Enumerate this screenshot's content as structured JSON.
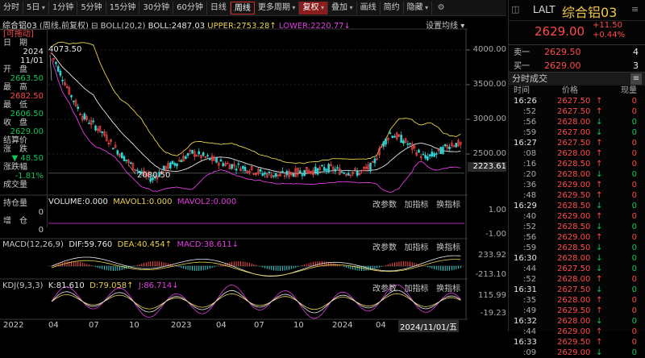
{
  "toolbar": {
    "items": [
      "分时",
      "5日",
      "1分钟",
      "5分钟",
      "15分钟",
      "30分钟",
      "60分钟",
      "日线",
      "周线",
      "更多周期",
      "复权",
      "叠加",
      "画线",
      "简约",
      "隐藏"
    ],
    "active": "周线"
  },
  "chart_header": {
    "name": "综合铝03",
    "mode": "(周线,前复权)",
    "boll": "BOLL(20,2)",
    "boll_val": "BOLL:2487.03",
    "upper": "UPPER:2753.28",
    "lower": "LOWER:2220.77",
    "set_ma": "设置均线"
  },
  "info": {
    "tag": "[可拖动]",
    "date_label": "日　期",
    "date_year": "2024",
    "date_md": "11/01",
    "open_label": "开　盘",
    "open": "2663.50",
    "high_label": "最　高",
    "high": "2682.50",
    "low_label": "最　低",
    "low": "2606.50",
    "close_label": "收　盘",
    "close": "2629.00",
    "settle_label": "结算价",
    "change_label": "涨　跌",
    "change": "48.50",
    "pct_label": "涨跌幅",
    "pct": "-1.81%",
    "vol_label": "成交量",
    "oi_label": "持仓量",
    "oi_chg_label": "增　仓",
    "zero": "0"
  },
  "price_axis": {
    "ticks": [
      "4000.00",
      "3500.00",
      "3000.00",
      "2500.00"
    ],
    "current": "2223.61",
    "max_label": "4073.50",
    "min_label": "2080.50"
  },
  "volume_panel": {
    "title": "VOLUME:0.000",
    "ma1": "MAVOL1:0.000",
    "ma2": "MAVOL2:0.000",
    "btns": [
      "改参数",
      "加指标",
      "换指标"
    ],
    "ticks": [
      "1.00",
      "-1.00"
    ]
  },
  "macd_panel": {
    "title": "MACD(12,26,9)",
    "dif": "DIF:59.760",
    "dea": "DEA:40.454",
    "macd": "MACD:38.611",
    "btns": [
      "改参数",
      "加指标",
      "换指标"
    ],
    "ticks": [
      "233.92",
      "-213.10"
    ]
  },
  "kdj_panel": {
    "title": "KDJ(9,3,3)",
    "k": "K:81.610",
    "d": "D:79.058",
    "j": "J:86.714",
    "btns": [
      "改参数",
      "加指标",
      "换指标"
    ],
    "ticks": [
      "115.99",
      "-19.23"
    ]
  },
  "time_axis": {
    "labels": [
      "2022",
      "04",
      "07",
      "10",
      "2023",
      "04",
      "07",
      "10",
      "2024",
      "04",
      "2024/11/01/五"
    ]
  },
  "quote": {
    "code": "LALT",
    "name": "综合铝03",
    "price": "2629.00",
    "change": "+11.50",
    "pct": "+0.44%",
    "sell_label": "卖一",
    "sell_price": "2629.50",
    "sell_vol": "4",
    "buy_label": "买一",
    "buy_price": "2629.00",
    "buy_vol": "3",
    "ticks_title": "分时成交",
    "col_time": "时间",
    "col_price": "价格",
    "col_vol": "现量"
  },
  "ticks": [
    {
      "t": "16:26",
      "p": "2627.50",
      "d": "up",
      "v": "0"
    },
    {
      "t": ":52",
      "p": "2627.50",
      "d": "up",
      "v": "0"
    },
    {
      "t": ":56",
      "p": "2628.00",
      "d": "dn",
      "v": "0"
    },
    {
      "t": ":59",
      "p": "2627.00",
      "d": "dn",
      "v": "0"
    },
    {
      "t": "16:27",
      "p": "2627.50",
      "d": "up",
      "v": "0"
    },
    {
      "t": ":08",
      "p": "2628.00",
      "d": "up",
      "v": "0"
    },
    {
      "t": ":16",
      "p": "2628.50",
      "d": "up",
      "v": "0"
    },
    {
      "t": ":20",
      "p": "2628.00",
      "d": "dn",
      "v": "0"
    },
    {
      "t": ":36",
      "p": "2629.00",
      "d": "up",
      "v": "0"
    },
    {
      "t": ":48",
      "p": "2629.50",
      "d": "up",
      "v": "0"
    },
    {
      "t": "16:29",
      "p": "2628.50",
      "d": "dn",
      "v": "0"
    },
    {
      "t": ":40",
      "p": "2629.00",
      "d": "up",
      "v": "0"
    },
    {
      "t": ":52",
      "p": "2628.50",
      "d": "dn",
      "v": "0"
    },
    {
      "t": ":56",
      "p": "2629.00",
      "d": "up",
      "v": "0"
    },
    {
      "t": ":59",
      "p": "2628.50",
      "d": "dn",
      "v": "0"
    },
    {
      "t": "16:30",
      "p": "2628.00",
      "d": "dn",
      "v": "0"
    },
    {
      "t": ":44",
      "p": "2627.50",
      "d": "dn",
      "v": "0"
    },
    {
      "t": ":52",
      "p": "2628.00",
      "d": "up",
      "v": "0"
    },
    {
      "t": "16:31",
      "p": "2627.50",
      "d": "dn",
      "v": "0"
    },
    {
      "t": ":35",
      "p": "2628.00",
      "d": "up",
      "v": "0"
    },
    {
      "t": ":49",
      "p": "2629.50",
      "d": "up",
      "v": "0"
    },
    {
      "t": "16:32",
      "p": "2628.00",
      "d": "dn",
      "v": "0"
    },
    {
      "t": ":44",
      "p": "2629.00",
      "d": "up",
      "v": "0"
    },
    {
      "t": "16:33",
      "p": "2629.50",
      "d": "up",
      "v": "0"
    },
    {
      "t": ":09",
      "p": "2629.00",
      "d": "dn",
      "v": "0"
    }
  ],
  "colors": {
    "up": "#ff4a4a",
    "down": "#16c45a",
    "boll_mid": "#e8e8e8",
    "boll_up": "#e8d24a",
    "boll_low": "#e23ce2"
  }
}
